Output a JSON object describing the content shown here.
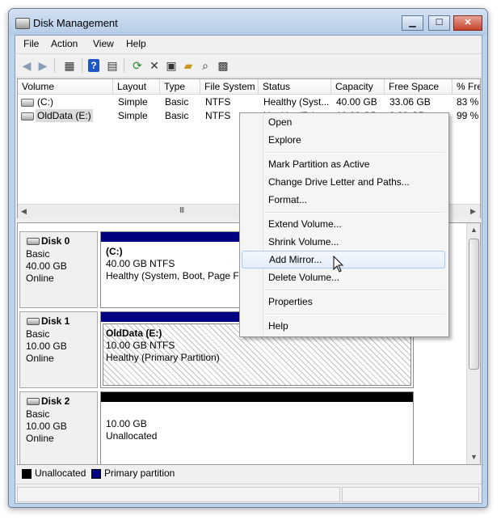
{
  "window": {
    "title": "Disk Management"
  },
  "menu": [
    "File",
    "Action",
    "View",
    "Help"
  ],
  "toolbar_icons": [
    "back-arrow-icon",
    "forward-arrow-icon",
    "console-tree-icon",
    "help-icon",
    "show-hide-icon",
    "refresh-icon",
    "delete-icon",
    "properties-icon",
    "open-folder-icon",
    "search-icon",
    "disk-settings-icon"
  ],
  "volume_table": {
    "columns": [
      "Volume",
      "Layout",
      "Type",
      "File System",
      "Status",
      "Capacity",
      "Free Space",
      "% Fre"
    ],
    "rows": [
      {
        "volume": "(C:)",
        "layout": "Simple",
        "type": "Basic",
        "fs": "NTFS",
        "status": "Healthy (Syst...",
        "capacity": "40.00 GB",
        "free": "33.06 GB",
        "pct": "83 %"
      },
      {
        "volume": "OldData (E:)",
        "layout": "Simple",
        "type": "Basic",
        "fs": "NTFS",
        "status": "Healthy (Pri...",
        "capacity": "10.00 GB",
        "free": "9.93 GB",
        "pct": "99 %"
      }
    ]
  },
  "scrollbar": {
    "grip": "III"
  },
  "disks": [
    {
      "name": "Disk 0",
      "type": "Basic",
      "size": "40.00 GB",
      "state": "Online",
      "partition": {
        "title": "(C:)",
        "line1": "40.00 GB NTFS",
        "line2": "Healthy (System, Boot, Page File, Active, Crash Dump, Primary Partition)"
      }
    },
    {
      "name": "Disk 1",
      "type": "Basic",
      "size": "10.00 GB",
      "state": "Online",
      "partition": {
        "title": "OldData  (E:)",
        "line1": "10.00 GB NTFS",
        "line2": "Healthy (Primary Partition)"
      }
    },
    {
      "name": "Disk 2",
      "type": "Basic",
      "size": "10.00 GB",
      "state": "Online",
      "partition": {
        "title": "",
        "line1": "10.00 GB",
        "line2": "Unallocated"
      }
    }
  ],
  "legend": {
    "unallocated": "Unallocated",
    "primary": "Primary partition",
    "colors": {
      "unallocated": "#000000",
      "primary": "#000080"
    }
  },
  "context_menu": {
    "items": [
      "Open",
      "Explore",
      "Mark Partition as Active",
      "Change Drive Letter and Paths...",
      "Format...",
      "Extend Volume...",
      "Shrink Volume...",
      "Add Mirror...",
      "Delete Volume...",
      "Properties",
      "Help"
    ],
    "highlighted": "Add Mirror..."
  },
  "colors": {
    "primary_bar": "#000080",
    "unallocated_bar": "#000000",
    "window_frame": "#bcd3ec"
  }
}
